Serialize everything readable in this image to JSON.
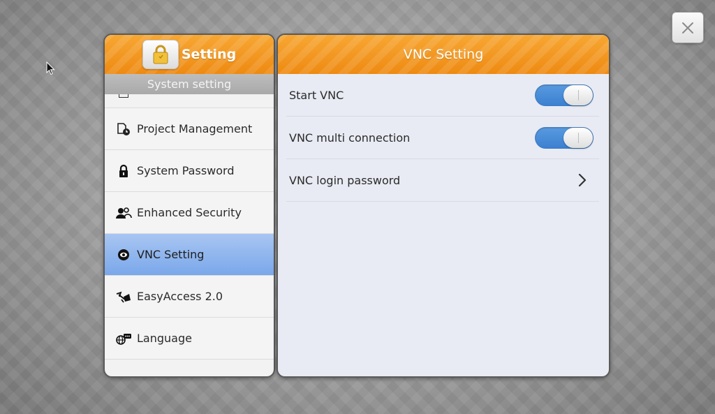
{
  "left_panel": {
    "title": "Setting",
    "subtitle": "System setting",
    "items": [
      {
        "label": "Project Management",
        "icon": "project-management-icon"
      },
      {
        "label": "System Password",
        "icon": "padlock-icon"
      },
      {
        "label": "Enhanced Security",
        "icon": "users-security-icon"
      },
      {
        "label": "VNC Setting",
        "icon": "eye-icon",
        "selected": true
      },
      {
        "label": "EasyAccess 2.0",
        "icon": "easyaccess-icon"
      },
      {
        "label": "Language",
        "icon": "language-globe-icon"
      }
    ]
  },
  "right_panel": {
    "title": "VNC Setting",
    "rows": [
      {
        "label": "Start VNC",
        "control": "toggle",
        "value": "on"
      },
      {
        "label": "VNC multi connection",
        "control": "toggle",
        "value": "on"
      },
      {
        "label": "VNC login password",
        "control": "chevron"
      }
    ]
  },
  "colors": {
    "header_orange": "#F29A1F",
    "selected_blue": "#8AB2EE",
    "toggle_blue": "#4A8CD8"
  }
}
